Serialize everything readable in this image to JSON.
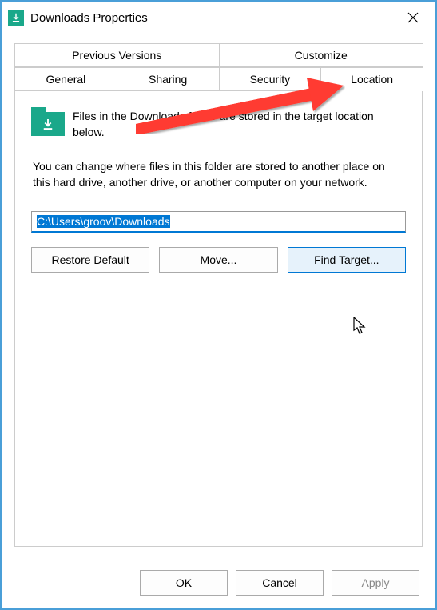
{
  "window": {
    "title": "Downloads Properties"
  },
  "tabs": {
    "row1": [
      "Previous Versions",
      "Customize"
    ],
    "row2": [
      "General",
      "Sharing",
      "Security",
      "Location"
    ],
    "active": "Location"
  },
  "location": {
    "info_text": "Files in the Downloads folder are stored in the target location below.",
    "description": "You can change where files in this folder are stored to another place on this hard drive, another drive, or another computer on your network.",
    "path": "C:\\Users\\groov\\Downloads",
    "buttons": {
      "restore": "Restore Default",
      "move": "Move...",
      "find_target": "Find Target..."
    }
  },
  "dialog_buttons": {
    "ok": "OK",
    "cancel": "Cancel",
    "apply": "Apply"
  }
}
